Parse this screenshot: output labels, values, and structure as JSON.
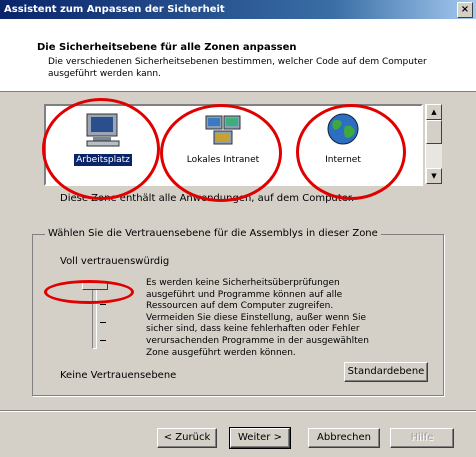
{
  "window": {
    "title": "Assistent zum Anpassen der Sicherheit",
    "close_glyph": "×"
  },
  "header": {
    "title": "Die Sicherheitsebene für alle Zonen anpassen",
    "subtitle": "Die verschiedenen Sicherheitsebenen bestimmen, welcher Code auf dem Computer ausgeführt werden kann."
  },
  "zones": {
    "items": [
      {
        "label": "Arbeitsplatz",
        "icon": "computer-icon",
        "selected": true
      },
      {
        "label": "Lokales Intranet",
        "icon": "intranet-icon",
        "selected": false
      },
      {
        "label": "Internet",
        "icon": "globe-icon",
        "selected": false
      }
    ],
    "scroll_up": "▲",
    "scroll_down": "▼",
    "description": "Diese Zone enthält alle Anwendungen, auf dem Computer."
  },
  "trust": {
    "group_title": "Wählen Sie die Vertrauensebene für die Assemblys in dieser Zone",
    "high_label": "Voll vertrauenswürdig",
    "low_label": "Keine Vertrauensebene",
    "level_description": "Es werden keine Sicherheitsüberprüfungen ausgeführt und Programme können auf alle Ressourcen auf dem Computer zugreifen. Vermeiden Sie diese Einstellung, außer wenn Sie sicher sind, dass keine fehlerhaften oder Fehler verursachenden Programme in der ausgewählten Zone ausgeführt werden können.",
    "default_button": "Standardebene",
    "slider_position": "top"
  },
  "buttons": {
    "back": "< Zurück",
    "next": "Weiter >",
    "cancel": "Abbrechen",
    "help": "Hilfe"
  },
  "colors": {
    "annotation": "#e00000",
    "selection": "#0a246a"
  }
}
